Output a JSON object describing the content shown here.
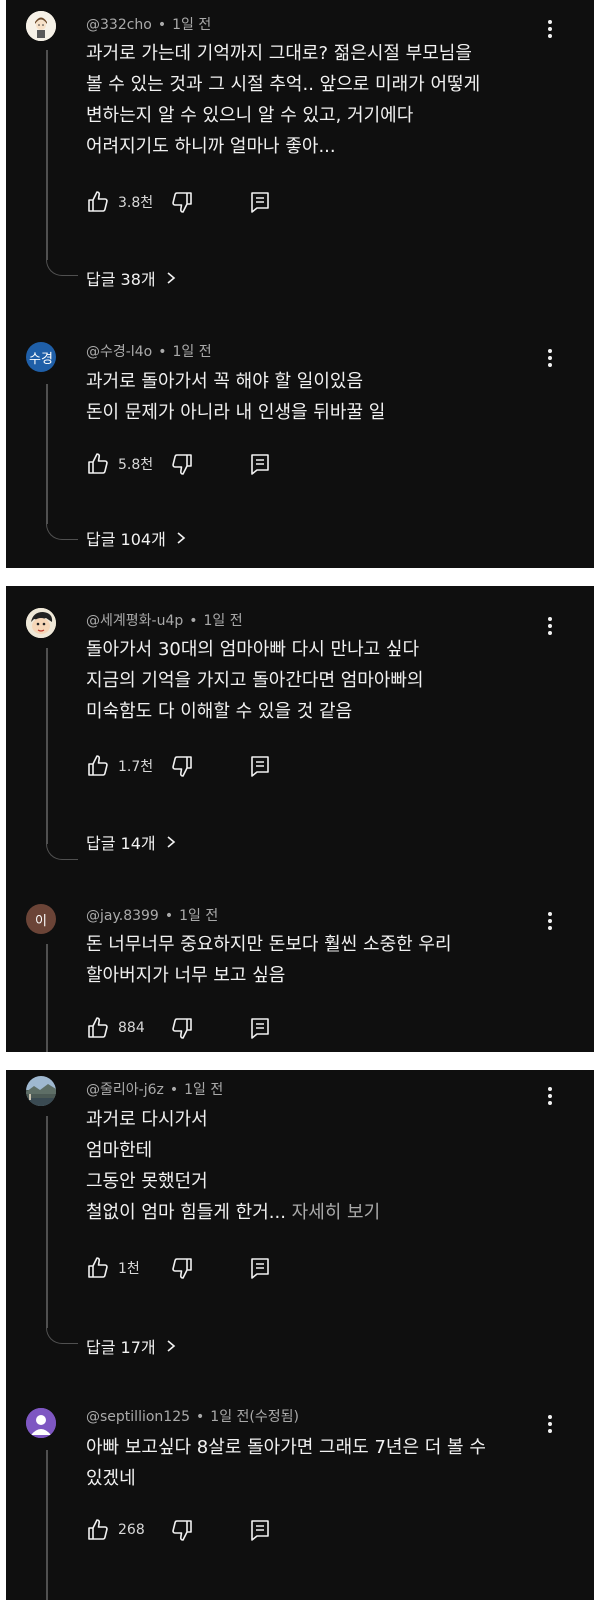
{
  "panels": [
    {
      "comments": [
        {
          "author": "@332cho",
          "time": "1일 전",
          "lines": [
            "과거로 가는데 기억까지 그대로? 젊은시절 부모님을",
            "볼 수 있는 것과 그 시절 추억.. 앞으로 미래가 어떻게",
            "변하는지 알 수 있으니 알 수 있고, 거기에다",
            "어려지기도 하니까 얼마나 좋아..."
          ],
          "likes": "3.8천",
          "replies": "답글 38개"
        },
        {
          "author": "@수경-l4o",
          "avatar_text": "수경",
          "avatar_color": "#1f5fa8",
          "time": "1일 전",
          "lines": [
            "과거로 돌아가서 꼭 해야 할 일이있음",
            "돈이 문제가 아니라 내 인생을 뒤바꿀 일"
          ],
          "likes": "5.8천",
          "replies": "답글 104개"
        }
      ]
    },
    {
      "comments": [
        {
          "author": "@세계평화-u4p",
          "time": "1일 전",
          "lines": [
            "돌아가서 30대의 엄마아빠 다시 만나고 싶다",
            "지금의 기억을 가지고 돌아간다면 엄마아빠의",
            "미숙함도 다 이해할 수 있을 것 같음"
          ],
          "likes": "1.7천",
          "replies": "답글 14개"
        },
        {
          "author": "@jay.8399",
          "avatar_text": "이",
          "avatar_color": "#6b4437",
          "time": "1일 전",
          "lines": [
            "돈 너무너무 중요하지만 돈보다 훨씬 소중한 우리",
            "할아버지가 너무 보고 싶음"
          ],
          "likes": "884"
        }
      ]
    },
    {
      "comments": [
        {
          "author": "@줄리아-j6z",
          "time": "1일 전",
          "lines": [
            "과거로 다시가서",
            "엄마한테",
            "그동안 못했던거",
            "철없이 엄마 힘들게 한거..."
          ],
          "more": " 자세히 보기",
          "likes": "1천",
          "replies": "답글 17개"
        },
        {
          "author": "@septillion125",
          "avatar_color": "#7e57c2",
          "time": "1일 전(수정됨)",
          "lines": [
            "아빠 보고싶다 8살로 돌아가면 그래도 7년은 더 볼 수",
            "있겠네"
          ],
          "likes": "268"
        }
      ]
    }
  ],
  "icons": {
    "like": "thumb-up-icon",
    "dislike": "thumb-down-icon",
    "reply": "reply-comment-icon",
    "menu": "more-vert-icon",
    "chevron": "chevron-right-icon"
  }
}
